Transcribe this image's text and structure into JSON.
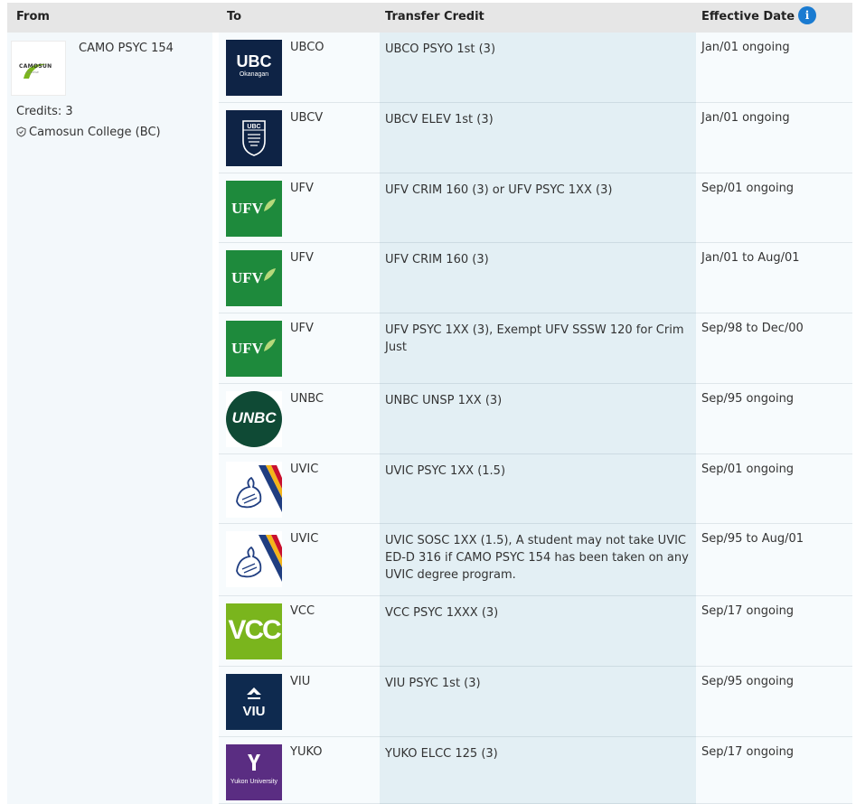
{
  "header": {
    "from": "From",
    "to": "To",
    "transfer_credit": "Transfer Credit",
    "effective_date": "Effective Date",
    "info_icon": "i"
  },
  "from": {
    "course": "CAMO PSYC 154",
    "credits": "Credits: 3",
    "institution": "Camosun College (BC)",
    "logo_text": "CAMOSUN",
    "logo_sub": "COLLEGE"
  },
  "colors": {
    "header_bg": "#e6e6e6",
    "info_blue": "#1a7bd1",
    "ubc_navy": "#0e2345",
    "ufv_green": "#1e8a3c",
    "unbc_green": "#0f4a35",
    "vcc_green": "#7ab51d",
    "viu_navy": "#0e2a4f",
    "yukon_purple": "#5a2d82"
  },
  "rows": [
    {
      "logo": "ubco",
      "logo_text": "UBC",
      "logo_sub": "Okanagan",
      "institution": "UBCO",
      "credit": "UBCO PSYO 1st (3)",
      "date": "Jan/01 ongoing"
    },
    {
      "logo": "ubcv",
      "institution": "UBCV",
      "credit": "UBCV ELEV 1st (3)",
      "date": "Jan/01 ongoing"
    },
    {
      "logo": "ufv",
      "logo_text": "UFV",
      "institution": "UFV",
      "credit": "UFV CRIM 160 (3) or UFV PSYC 1XX (3)",
      "date": "Sep/01 ongoing"
    },
    {
      "logo": "ufv",
      "logo_text": "UFV",
      "institution": "UFV",
      "credit": "UFV CRIM 160 (3)",
      "date": "Jan/01 to Aug/01"
    },
    {
      "logo": "ufv",
      "logo_text": "UFV",
      "institution": "UFV",
      "credit": "UFV PSYC 1XX (3), Exempt UFV SSSW 120 for Crim Just",
      "date": "Sep/98 to Dec/00"
    },
    {
      "logo": "unbc",
      "logo_text": "UNBC",
      "institution": "UNBC",
      "credit": "UNBC UNSP 1XX (3)",
      "date": "Sep/95 ongoing"
    },
    {
      "logo": "uvic",
      "institution": "UVIC",
      "credit": "UVIC PSYC 1XX (1.5)",
      "date": "Sep/01 ongoing"
    },
    {
      "logo": "uvic",
      "institution": "UVIC",
      "credit": "UVIC SOSC 1XX (1.5), A student may not take UVIC ED-D 316 if CAMO PSYC 154 has been taken on any UVIC degree program.",
      "date": "Sep/95 to Aug/01"
    },
    {
      "logo": "vcc",
      "logo_text": "VCC",
      "institution": "VCC",
      "credit": "VCC PSYC 1XXX (3)",
      "date": "Sep/17 ongoing"
    },
    {
      "logo": "viu",
      "logo_text": "VIU",
      "institution": "VIU",
      "credit": "VIU PSYC 1st (3)",
      "date": "Sep/95 ongoing"
    },
    {
      "logo": "yuko",
      "logo_text": "Yukon University",
      "institution": "YUKO",
      "credit": "YUKO ELCC 125 (3)",
      "date": "Sep/17 ongoing"
    }
  ]
}
